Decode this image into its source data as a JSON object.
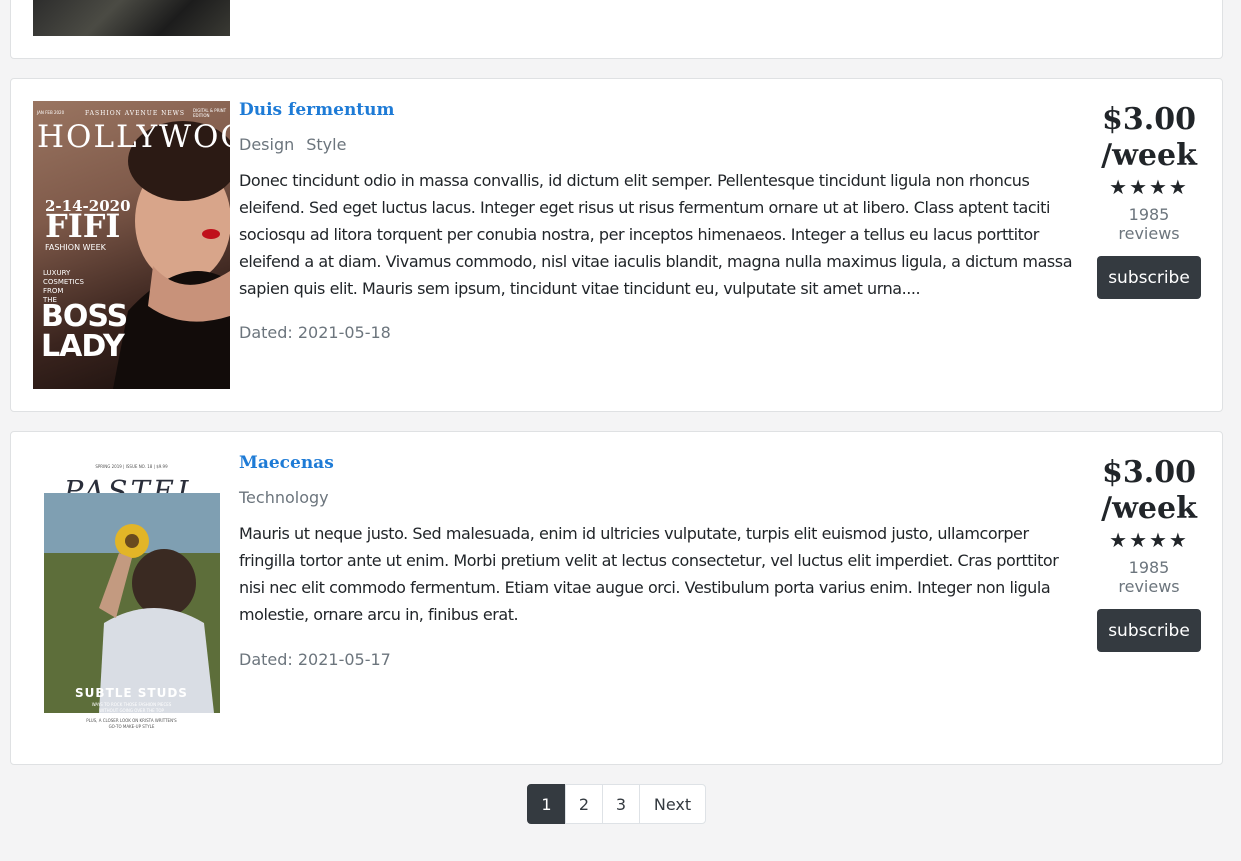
{
  "listings": [
    {
      "title": "Duis fermentum",
      "tags": [
        "Design",
        "Style"
      ],
      "description": "Donec tincidunt odio in massa convallis, id dictum elit semper. Pellentesque tincidunt ligula non rhoncus eleifend. Sed eget luctus lacus. Integer eget risus ut risus fermentum ornare ut at libero. Class aptent taciti sociosqu ad litora torquent per conubia nostra, per inceptos himenaeos. Integer a tellus eu lacus porttitor eleifend a at diam. Vivamus commodo, nisl vitae iaculis blandit, magna nulla maximus ligula, a dictum massa sapien quis elit. Mauris sem ipsum, tincidunt vitae tincidunt eu, vulputate sit amet urna....",
      "dated": "Dated: 2021-05-18",
      "price_line1": "$3.00",
      "price_line2": "/week",
      "stars": "★★★★",
      "reviews": "1985 reviews",
      "subscribe_label": "subscribe",
      "cover": {
        "masthead": "HOLLYWOOD",
        "top_left": "JAN FEB 2020",
        "top_center": "FASHION AVENUE NEWS",
        "top_right": "DIGITAL & PRINT EDITION",
        "date": "2-14-2020",
        "headline": "FIFI",
        "subline": "FASHION WEEK",
        "small1": "LUXURY",
        "small2": "COSMETICS",
        "small3": "FROM",
        "small4": "THE",
        "boss1": "BOSS",
        "boss2": "LADY"
      }
    },
    {
      "title": "Maecenas",
      "tags": [
        "Technology"
      ],
      "description": "Mauris ut neque justo. Sed malesuada, enim id ultricies vulputate, turpis elit euismod justo, ullamcorper fringilla tortor ante ut enim. Morbi pretium velit at lectus consectetur, vel luctus elit imperdiet. Cras porttitor nisi nec elit commodo fermentum. Etiam vitae augue orci. Vestibulum porta varius enim. Integer non ligula molestie, ornare arcu in, finibus erat.",
      "dated": "Dated: 2021-05-17",
      "price_line1": "$3.00",
      "price_line2": "/week",
      "stars": "★★★★",
      "reviews": "1985 reviews",
      "subscribe_label": "subscribe",
      "cover": {
        "topline": "SPRING 2019 | ISSUE NO. 18 | $9.99",
        "masthead": "PASTEL",
        "headline": "SUBTLE STUDS",
        "sub1": "WAYS TO ROCK THOSE FASHION PIECES",
        "sub2": "WITHOUT GOING OVER THE TOP",
        "bottom1": "PLUS, A CLOSER LOOK ON KRISTA WRITTEN'S",
        "bottom2": "GO-TO MAKE-UP STYLE"
      }
    }
  ],
  "pagination": {
    "pages": [
      "1",
      "2",
      "3"
    ],
    "active": "1",
    "next_label": "Next"
  }
}
